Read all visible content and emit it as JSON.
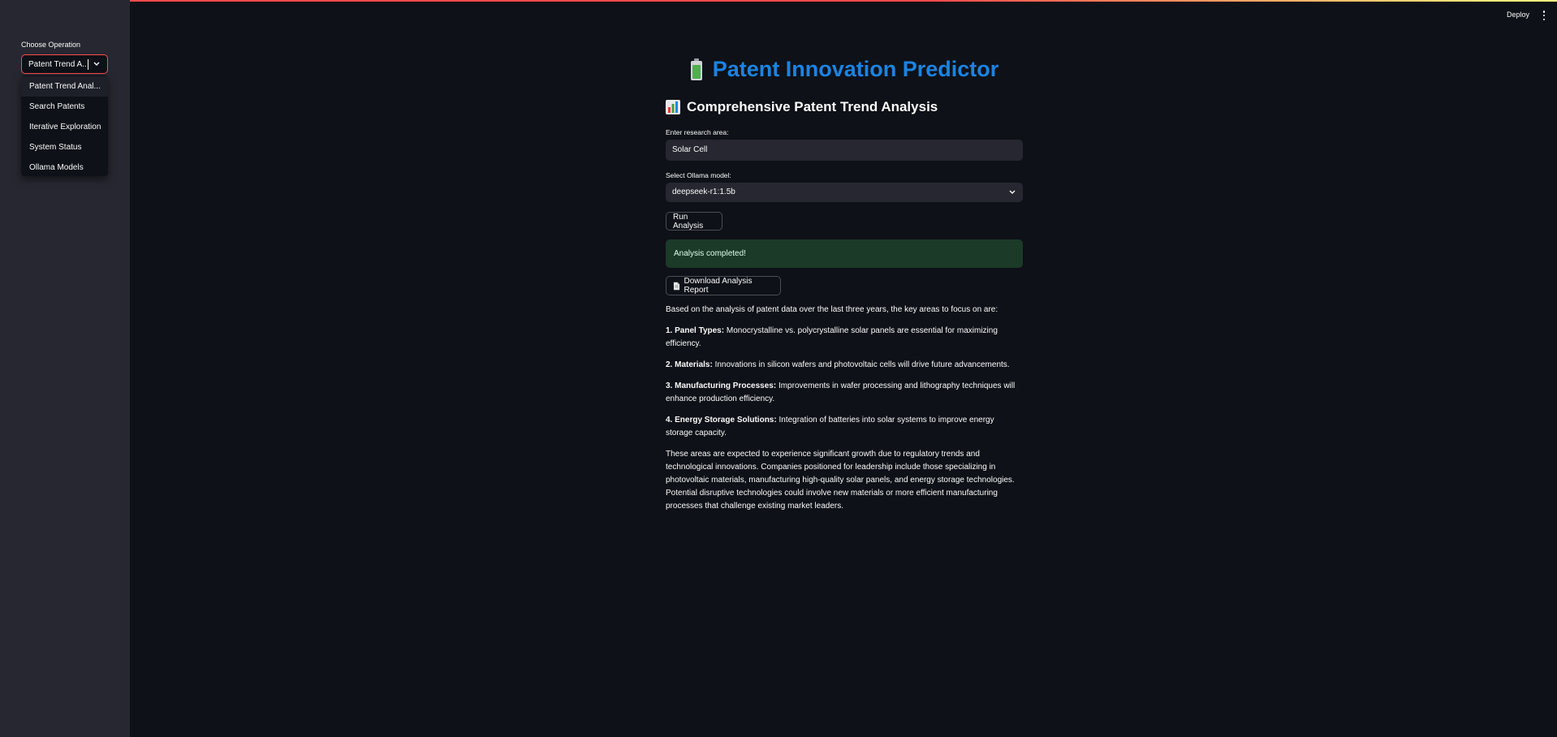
{
  "header": {
    "deploy_label": "Deploy",
    "menu_icon": "kebab-menu-icon"
  },
  "sidebar": {
    "label": "Choose Operation",
    "selected": "Patent Trend A...",
    "options": [
      "Patent Trend Anal...",
      "Search Patents",
      "Iterative Exploration",
      "System Status",
      "Ollama Models"
    ]
  },
  "main": {
    "title": "Patent Innovation Predictor",
    "title_icon": "battery-icon",
    "section_title": "Comprehensive Patent Trend Analysis",
    "section_icon": "bar-chart-icon",
    "research_label": "Enter research area:",
    "research_value": "Solar Cell",
    "model_label": "Select Ollama model:",
    "model_value": "deepseek-r1:1.5b",
    "run_button": "Run Analysis",
    "success_message": "Analysis completed!",
    "download_button": "Download Analysis Report",
    "download_icon": "document-icon",
    "intro": "Based on the analysis of patent data over the last three years, the key areas to focus on are:",
    "points": [
      {
        "num": "1.",
        "title": "Panel Types:",
        "text": "Monocrystalline vs. polycrystalline solar panels are essential for maximizing efficiency."
      },
      {
        "num": "2.",
        "title": "Materials:",
        "text": "Innovations in silicon wafers and photovoltaic cells will drive future advancements."
      },
      {
        "num": "3.",
        "title": "Manufacturing Processes:",
        "text": "Improvements in wafer processing and lithography techniques will enhance production efficiency."
      },
      {
        "num": "4.",
        "title": "Energy Storage Solutions:",
        "text": "Integration of batteries into solar systems to improve energy storage capacity."
      }
    ],
    "conclusion": "These areas are expected to experience significant growth due to regulatory trends and technological innovations. Companies positioned for leadership include those specializing in photovoltaic materials, manufacturing high-quality solar panels, and energy storage technologies. Potential disruptive technologies could involve new materials or more efficient manufacturing processes that challenge existing market leaders."
  },
  "colors": {
    "accent": "#ff4b4b",
    "title": "#1c83e1",
    "background": "#0e1117",
    "sidebar": "#262730",
    "success_bg": "#1b3a28"
  }
}
